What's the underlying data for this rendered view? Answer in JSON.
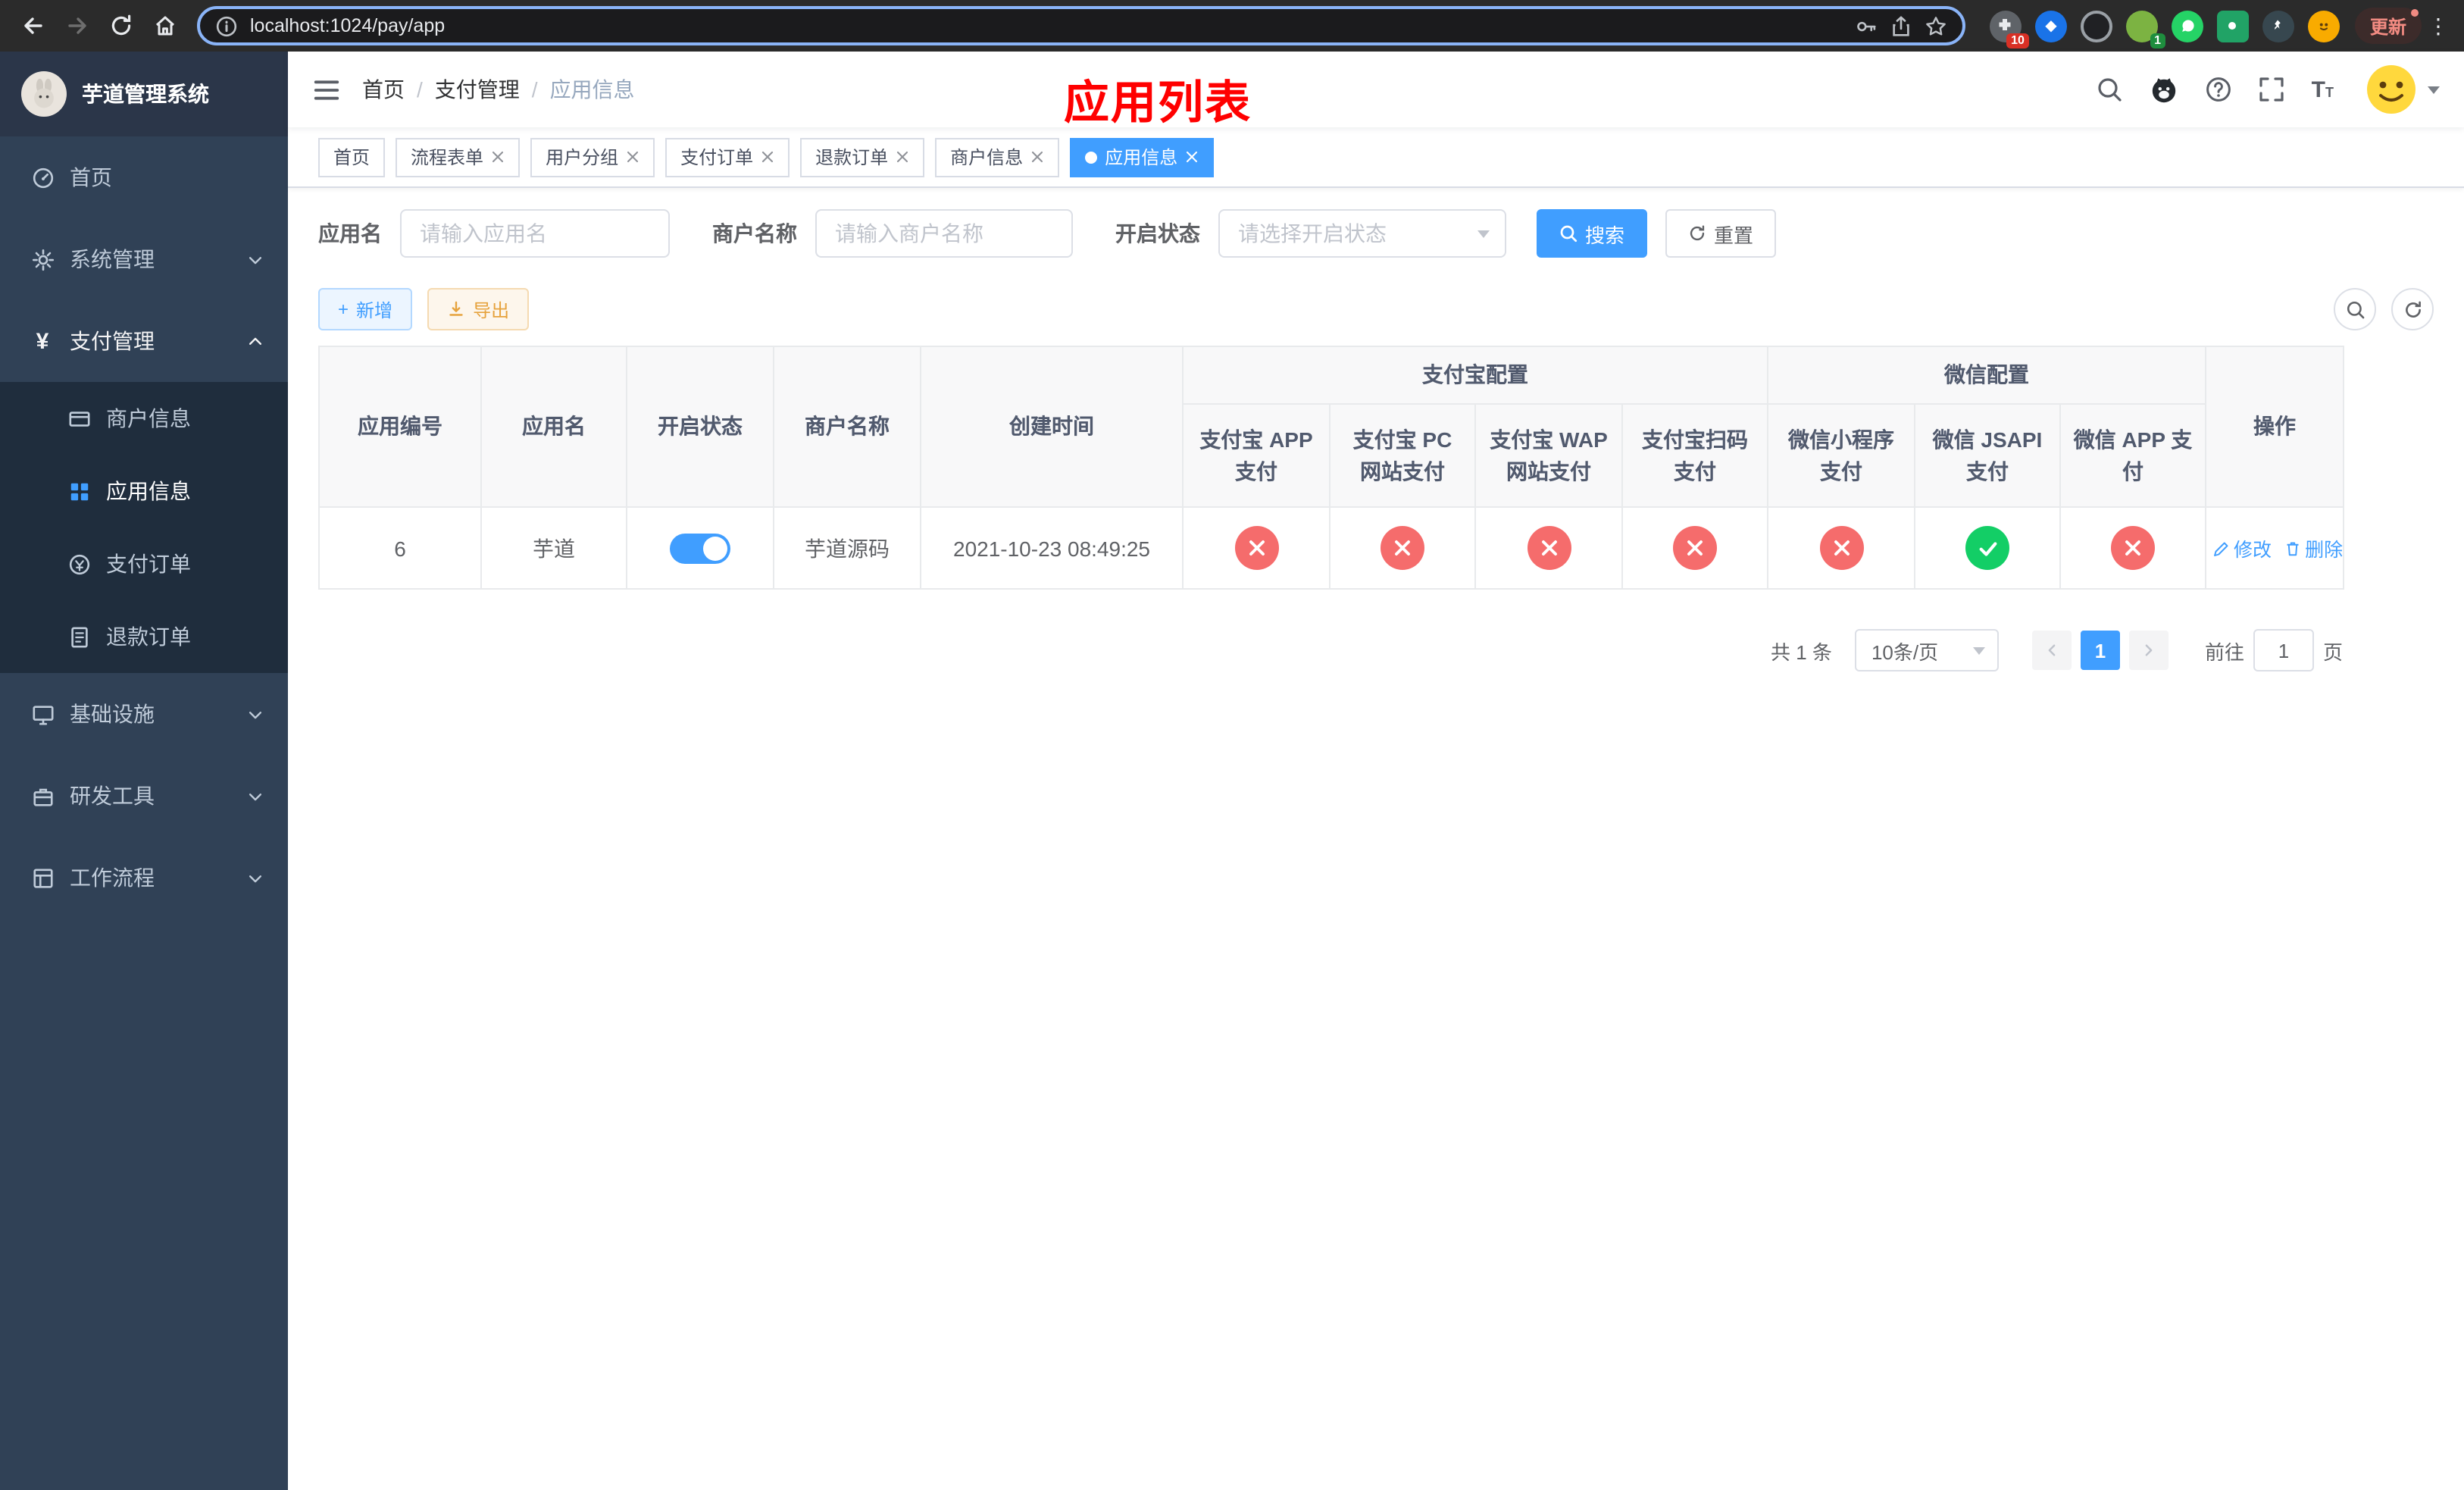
{
  "colors": {
    "accent": "#409eff",
    "danger": "#f56c6c",
    "success": "#13ce66",
    "warning": "#e6a23c",
    "sidebar_bg": "#304156",
    "sidebar_submenu_bg": "#1f2d3d",
    "overlay_title_color": "#ff0000"
  },
  "browser": {
    "url": "localhost:1024/pay/app",
    "update_label": "更新",
    "extension_badge_puzzle": "10",
    "extension_badge_leaf": "1"
  },
  "overlay_title": "应用列表",
  "sidebar": {
    "app_title": "芋道管理系统",
    "items": [
      {
        "label": "首页"
      },
      {
        "label": "系统管理"
      },
      {
        "label": "支付管理"
      },
      {
        "label": "基础设施"
      },
      {
        "label": "研发工具"
      },
      {
        "label": "工作流程"
      }
    ],
    "payment_children": [
      {
        "label": "商户信息"
      },
      {
        "label": "应用信息"
      },
      {
        "label": "支付订单"
      },
      {
        "label": "退款订单"
      }
    ]
  },
  "breadcrumb": {
    "items": [
      "首页",
      "支付管理",
      "应用信息"
    ],
    "separator": "/"
  },
  "tabs": [
    {
      "label": "首页"
    },
    {
      "label": "流程表单"
    },
    {
      "label": "用户分组"
    },
    {
      "label": "支付订单"
    },
    {
      "label": "退款订单"
    },
    {
      "label": "商户信息"
    },
    {
      "label": "应用信息"
    }
  ],
  "filters": {
    "app_name_label": "应用名",
    "app_name_placeholder": "请输入应用名",
    "merchant_label": "商户名称",
    "merchant_placeholder": "请输入商户名称",
    "status_label": "开启状态",
    "status_placeholder": "请选择开启状态",
    "search_label": "搜索",
    "reset_label": "重置"
  },
  "toolbar": {
    "add_label": "新增",
    "export_label": "导出"
  },
  "table": {
    "col_app_id": "应用编号",
    "col_app_name": "应用名",
    "col_status": "开启状态",
    "col_merchant": "商户名称",
    "col_created": "创建时间",
    "group_alipay": "支付宝配置",
    "group_wechat": "微信配置",
    "col_alipay_app": "支付宝 APP 支付",
    "col_alipay_pc": "支付宝 PC 网站支付",
    "col_alipay_wap": "支付宝 WAP 网站支付",
    "col_alipay_qr": "支付宝扫码支付",
    "col_wechat_mini": "微信小程序支付",
    "col_wechat_jsapi": "微信 JSAPI 支付",
    "col_wechat_app": "微信 APP 支付",
    "col_actions": "操作",
    "rows": [
      {
        "app_id": "6",
        "app_name": "芋道",
        "status_on": "on",
        "merchant": "芋道源码",
        "created": "2021-10-23 08:49:25",
        "alipay_app": "no",
        "alipay_pc": "no",
        "alipay_wap": "no",
        "alipay_qr": "no",
        "wechat_mini": "no",
        "wechat_jsapi": "yes",
        "wechat_app": "no",
        "edit_label": "修改",
        "delete_label": "删除"
      }
    ]
  },
  "pagination": {
    "total_text": "共 1 条",
    "page_size": "10条/页",
    "current_page": "1",
    "goto_label": "前往",
    "goto_value": "1",
    "page_suffix": "页"
  }
}
